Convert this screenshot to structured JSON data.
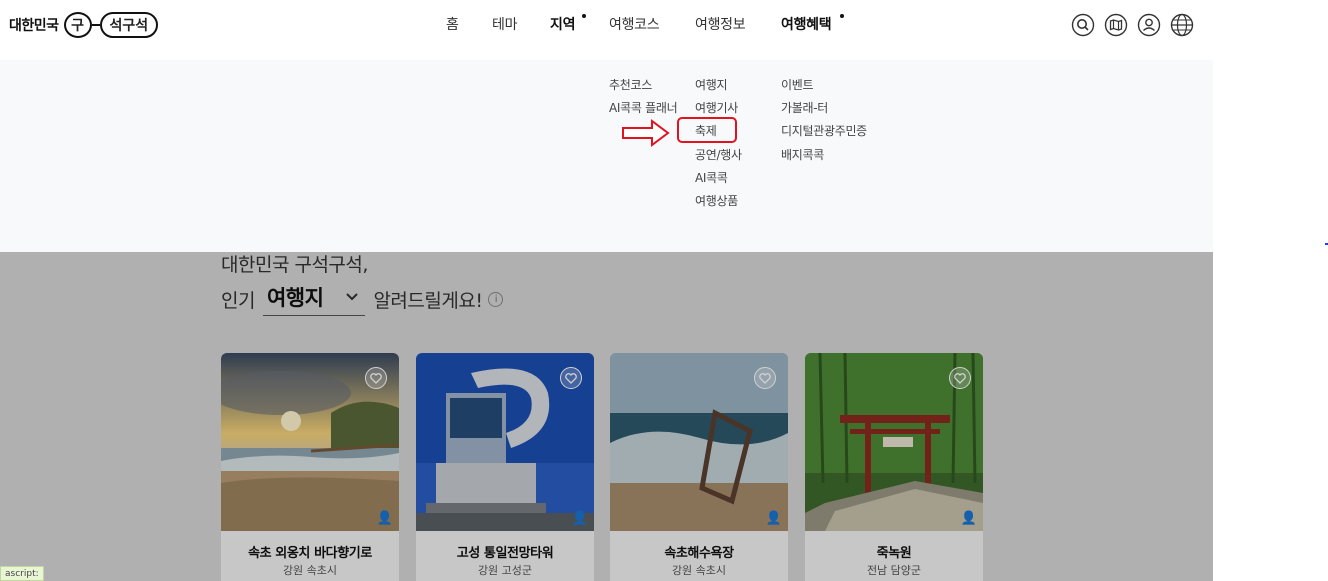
{
  "logo": {
    "text": "대한민국",
    "circle": "구",
    "pill": "석구석"
  },
  "gnb": {
    "items": [
      {
        "label": "홈"
      },
      {
        "label": "테마"
      },
      {
        "label": "지역"
      },
      {
        "label": "여행코스"
      },
      {
        "label": "여행정보"
      },
      {
        "label": "여행혜택"
      }
    ]
  },
  "utility": [
    {
      "icon": "search-icon"
    },
    {
      "icon": "map-icon"
    },
    {
      "icon": "user-icon"
    },
    {
      "icon": "globe-icon"
    }
  ],
  "mega_menu": {
    "course": [
      "추천코스",
      "AI콕콕 플래너"
    ],
    "info": [
      "여행지",
      "여행기사",
      "축제",
      "공연/행사",
      "AI콕콕",
      "여행상품"
    ],
    "benefit": [
      "이벤트",
      "가볼래-터",
      "디지털관광주민증",
      "배지콕콕"
    ],
    "highlighted": "축제",
    "highlight_color": "#e0141e"
  },
  "section": {
    "headline1": "대한민국 구석구석,",
    "headline2_prefix": "인기",
    "select_value": "여행지",
    "headline2_suffix": "알려드릴게요!",
    "info_symbol": "i"
  },
  "cards": [
    {
      "title": "속초 외옹치 바다향기로",
      "region": "강원 속초시"
    },
    {
      "title": "고성 통일전망타워",
      "region": "강원 고성군"
    },
    {
      "title": "속초해수욕장",
      "region": "강원 속초시"
    },
    {
      "title": "죽녹원",
      "region": "전남 담양군"
    }
  ],
  "status": {
    "text": "ascript:"
  }
}
